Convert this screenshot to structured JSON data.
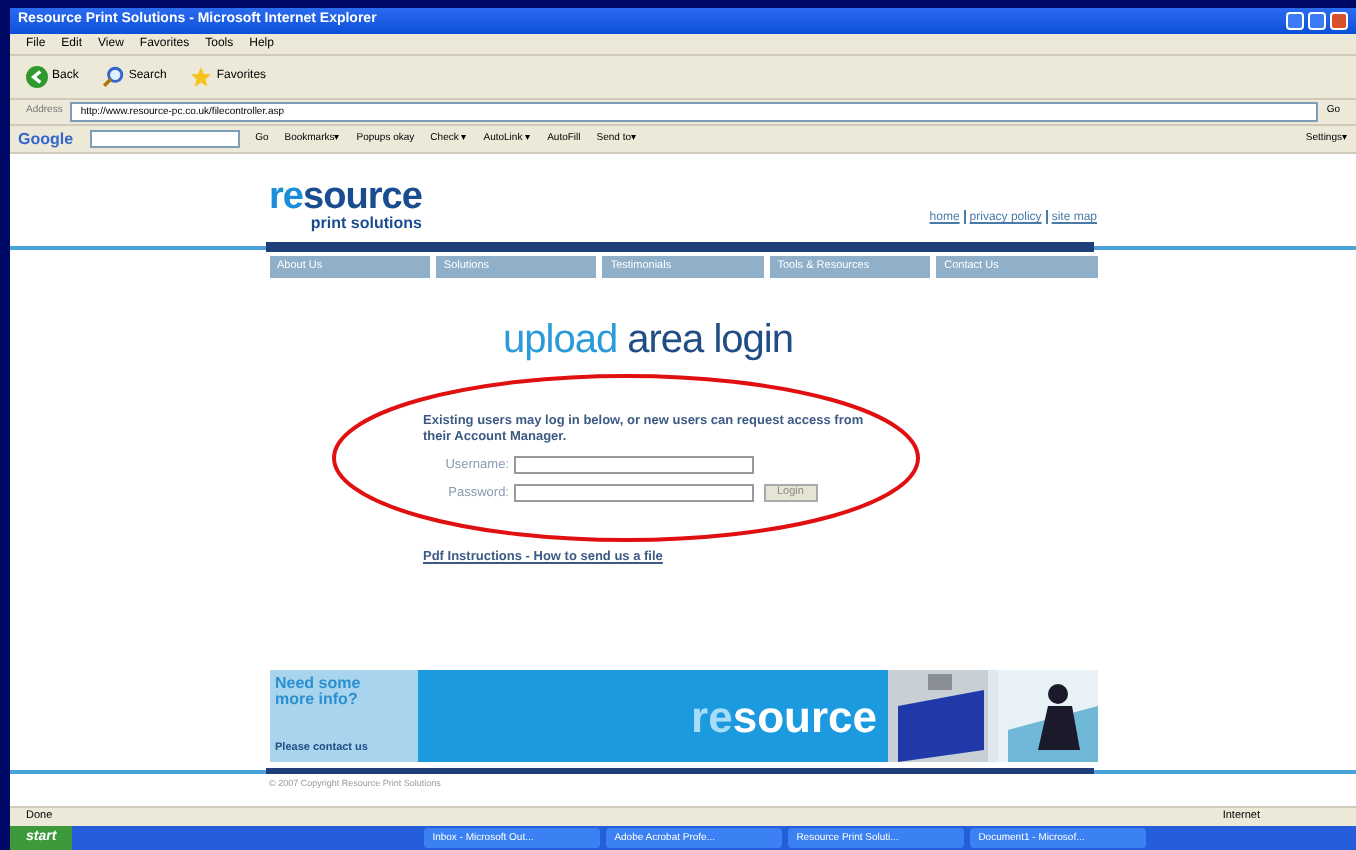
{
  "window": {
    "title": "Resource Print Solutions - Microsoft Internet Explorer"
  },
  "menu": [
    "File",
    "Edit",
    "View",
    "Favorites",
    "Tools",
    "Help"
  ],
  "toolbar": [
    {
      "kind": "back",
      "label": "Back"
    },
    {
      "kind": "search",
      "label": "Search"
    },
    {
      "kind": "favorites",
      "label": "Favorites"
    }
  ],
  "address": {
    "label": "Address",
    "value": "http://www.resource-pc.co.uk/filecontroller.asp",
    "go": "Go"
  },
  "google_bar": {
    "logo": "Google",
    "go": "Go",
    "items": [
      "Bookmarks▾",
      "Popups okay",
      "Check ▾",
      "AutoLink ▾",
      "AutoFill",
      "Send to▾"
    ],
    "settings": "Settings▾"
  },
  "page": {
    "logo": {
      "prefix": "re",
      "main": "source",
      "tagline": "print solutions"
    },
    "top_links": [
      "home",
      "privacy policy",
      "site map"
    ],
    "nav": [
      "About Us",
      "Solutions",
      "Testimonials",
      "Tools & Resources",
      "Contact Us"
    ],
    "heading": {
      "first": "upload",
      "rest": "area login"
    },
    "intro": "Existing users may log in below, or new users can request access from their Account Manager.",
    "fields": [
      {
        "label": "Username:"
      },
      {
        "label": "Password:"
      }
    ],
    "login_button": "Login",
    "help_link": "Pdf Instructions - How to send us a file",
    "banner": {
      "title": "Need some more info?",
      "contact": "Please contact us",
      "prefix": "re",
      "main": "source"
    },
    "copyright": "© 2007 Copyright Resource Print Solutions"
  },
  "status_bar": {
    "text": "Done",
    "zone": "Internet"
  },
  "taskbar": {
    "start": "start",
    "items": [
      "Inbox - Microsoft Out...",
      "Adobe Acrobat Profe...",
      "Resource Print Soluti...",
      "Document1 - Microsof..."
    ]
  }
}
